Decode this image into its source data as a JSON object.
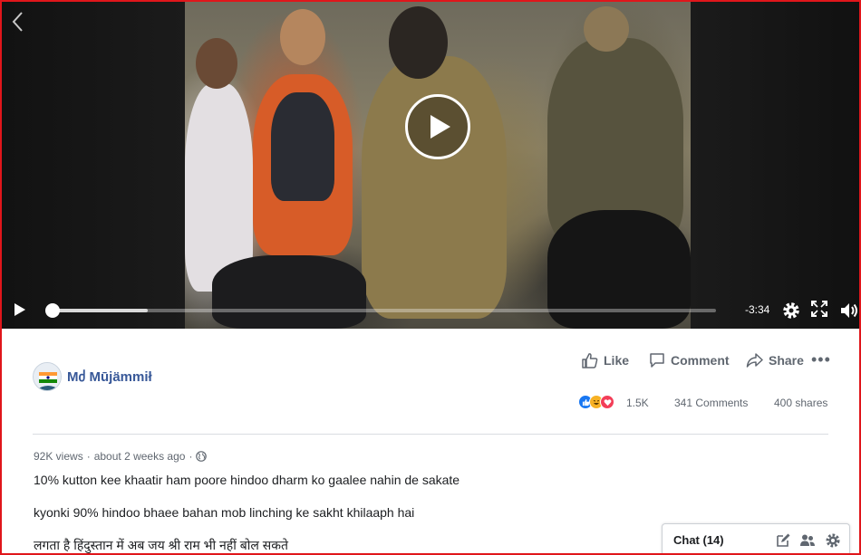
{
  "video": {
    "time_remaining": "-3:34",
    "progress_loaded": 0.15,
    "progress_played": 0.0
  },
  "post": {
    "author": "Mძ Mūjämmił",
    "actions": {
      "like": "Like",
      "comment": "Comment",
      "share": "Share"
    },
    "reactions_count": "1.5K",
    "comments_count": "341 Comments",
    "shares_count": "400 shares",
    "views": "92K views",
    "time_ago": "about 2 weeks ago",
    "lines": [
      "10% kutton kee khaatir ham poore hindoo dharm ko gaalee nahin de sakate",
      "kyonki 90% hindoo bhaee bahan mob linching ke sakht khilaaph hai",
      "लगता है हिंदुस्तान में अब जय श्री राम भी नहीं बोल सकते"
    ]
  },
  "chat": {
    "label": "Chat (14)"
  },
  "icons": {
    "back": "chevron-left-icon",
    "play": "play-icon",
    "settings": "gear-icon",
    "fullscreen": "fullscreen-icon",
    "volume": "volume-icon",
    "like": "thumbs-up-icon",
    "comment": "comment-bubble-icon",
    "share": "share-arrow-icon",
    "globe": "globe-icon",
    "compose": "compose-icon",
    "contacts": "contacts-icon"
  },
  "colors": {
    "accent": "#385898",
    "border": "#e0161b",
    "like_blue": "#1877f2",
    "haha_yellow": "#f7b125",
    "love_red": "#f33e58"
  }
}
